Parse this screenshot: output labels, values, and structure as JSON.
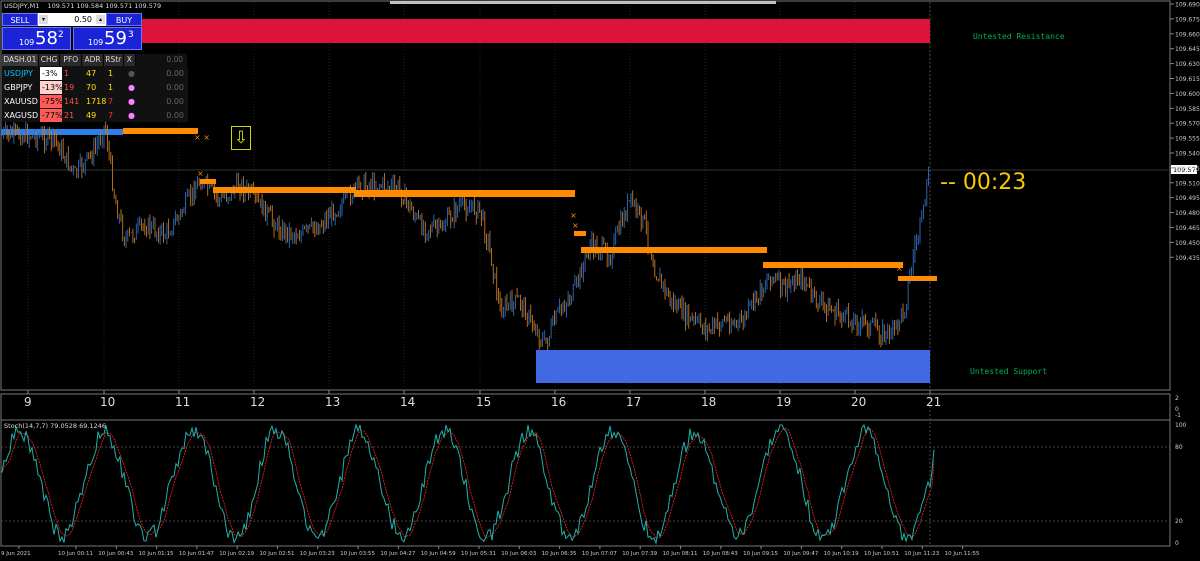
{
  "window": {
    "symbol_info": "USDJPY,M1",
    "ohlc": "109.571 109.584 109.571 109.579"
  },
  "trade_panel": {
    "sell_label": "SELL",
    "buy_label": "BUY",
    "lot_value": "0.50",
    "sell_price_prefix": "109",
    "sell_price_big": "58",
    "sell_price_sup": "2",
    "buy_price_prefix": "109",
    "buy_price_big": "59",
    "buy_price_sup": "3"
  },
  "dashboard": {
    "title": "DASH.01",
    "headers": [
      "CHG",
      "PFO",
      "ADR",
      "RStr",
      "X"
    ],
    "header_value": "0.00",
    "rows": [
      {
        "symbol": "USDJPY",
        "chg": "-3%",
        "pfo": "1",
        "adr": "47",
        "rstr": "1",
        "value": "0.00",
        "chg_color": "#ffffff"
      },
      {
        "symbol": "GBPJPY",
        "chg": "-13%",
        "pfo": "19",
        "adr": "70",
        "rstr": "1",
        "value": "0.00",
        "chg_color": "#ffd0d0"
      },
      {
        "symbol": "XAUUSD",
        "chg": "-75%",
        "pfo": "141",
        "adr": "1718",
        "rstr": "7",
        "value": "0.00",
        "chg_color": "#ff5a5a"
      },
      {
        "symbol": "XAGUSD",
        "chg": "-77%",
        "pfo": "21",
        "adr": "49",
        "rstr": "7",
        "value": "0.00",
        "chg_color": "#ff5a5a"
      }
    ]
  },
  "timer": "-- 00:23",
  "zones": {
    "resistance_label": "Untested Resistance",
    "support_label": "Untested Support"
  },
  "current_price_label": "109.579",
  "price_axis": [
    "109.690",
    "109.675",
    "109.660",
    "109.645",
    "109.630",
    "109.615",
    "109.600",
    "109.585",
    "109.570",
    "109.555",
    "109.540",
    "109.525",
    "109.510",
    "109.495",
    "109.480",
    "109.465",
    "109.450",
    "109.435"
  ],
  "day_axis": [
    "9",
    "10",
    "11",
    "12",
    "13",
    "14",
    "15",
    "16",
    "17",
    "18",
    "19",
    "20",
    "21"
  ],
  "separator_axis": [
    "2",
    "0",
    "-1"
  ],
  "stochastic": {
    "label": "Stoch(14,7,7) 79.0528 69.1246",
    "levels": [
      "100",
      "80",
      "20",
      "0"
    ]
  },
  "time_axis": [
    "9 Jun 2021",
    "10 Jun 00:11",
    "10 Jun 00:43",
    "10 Jun 01:15",
    "10 Jun 01:47",
    "10 Jun 02:19",
    "10 Jun 02:51",
    "10 Jun 03:23",
    "10 Jun 03:55",
    "10 Jun 04:27",
    "10 Jun 04:59",
    "10 Jun 05:31",
    "10 Jun 06:03",
    "10 Jun 06:35",
    "10 Jun 07:07",
    "10 Jun 07:39",
    "10 Jun 08:11",
    "10 Jun 08:43",
    "10 Jun 09:15",
    "10 Jun 09:47",
    "10 Jun 10:19",
    "10 Jun 10:51",
    "10 Jun 11:23",
    "10 Jun 11:55"
  ],
  "colors": {
    "resistance": "#dc143c",
    "support": "#4169e1",
    "level_line": "#ff8c00",
    "candle_up": "#2f6fbf",
    "candle_down": "#c87820",
    "stoch_main": "#20b2aa",
    "stoch_signal": "#ff2020",
    "timer": "#f7c800",
    "zone_label": "#00b050"
  }
}
